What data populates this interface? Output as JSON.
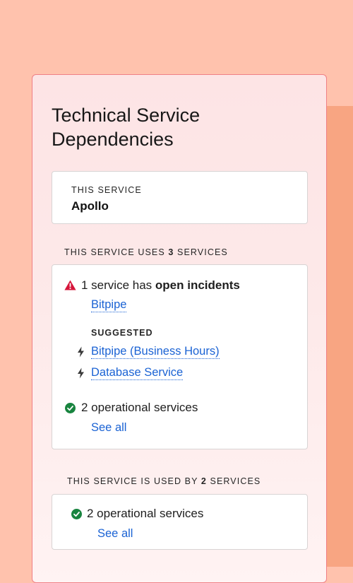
{
  "panel": {
    "title": "Technical Service Dependencies"
  },
  "this_service": {
    "label": "THIS SERVICE",
    "name": "Apollo"
  },
  "uses": {
    "label_prefix": "THIS SERVICE USES",
    "count": "3",
    "label_suffix": "SERVICES",
    "incidents_prefix": "1 service has",
    "incidents_strong": "open incidents",
    "incident_service": "Bitpipe",
    "suggested_label": "SUGGESTED",
    "suggested": [
      "Bitpipe (Business Hours)",
      "Database Service"
    ],
    "operational_text": "2 operational services",
    "see_all": "See all"
  },
  "used_by": {
    "label_prefix": "THIS SERVICE IS USED BY",
    "count": "2",
    "label_suffix": "SERVICES",
    "operational_text": "2 operational services",
    "see_all": "See all"
  },
  "colors": {
    "background": "#ffc2ad",
    "panel_border": "#f07f85",
    "link": "#1b63d4",
    "warning": "#d6153a",
    "success": "#18843f"
  },
  "icons": [
    "warning-icon",
    "lightning-icon",
    "check-circle-icon"
  ]
}
